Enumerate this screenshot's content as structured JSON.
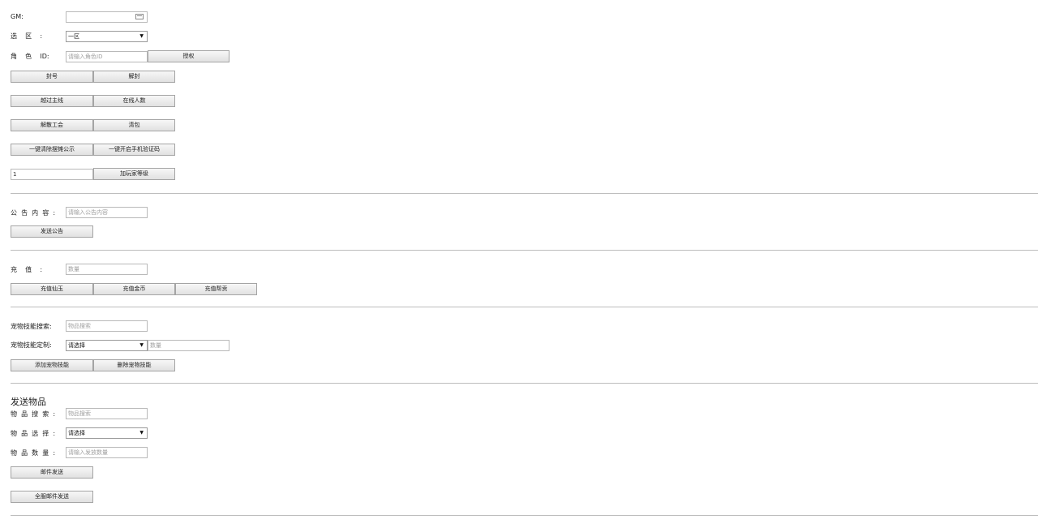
{
  "gm": {
    "label": "GM:",
    "value": ""
  },
  "zone": {
    "label": "选    区    :",
    "selected": "一区"
  },
  "role": {
    "label": "角    色    ID:",
    "placeholder": "请输入角色ID",
    "authorize_btn": "授权"
  },
  "row_ban": {
    "ban": "封号",
    "unban": "解封"
  },
  "row_main": {
    "skip_main": "越过主线",
    "online": "在线人数"
  },
  "row_guild": {
    "disband": "解散工会",
    "clear_bag": "清包"
  },
  "row_onekey": {
    "clear_stall": "一键清除摆摊公示",
    "enable_sms": "一键开启手机验证码"
  },
  "row_level": {
    "value": "1",
    "btn": "加玩家等级"
  },
  "announce": {
    "label": "公  告  内  容  :",
    "placeholder": "请输入公告内容",
    "btn": "发送公告"
  },
  "recharge": {
    "label": "充    值    :",
    "placeholder": "数量",
    "btn_jade": "充值仙玉",
    "btn_gold": "充值金币",
    "btn_guild": "充值帮贡"
  },
  "pet": {
    "search_label": "宠物技能搜索:",
    "search_placeholder": "物品搜索",
    "custom_label": "宠物技能定制:",
    "custom_selected": "请选择",
    "qty_placeholder": "数量",
    "add_btn": "添加宠物技能",
    "del_btn": "删除宠物技能"
  },
  "send": {
    "title": "发送物品",
    "search_label": "物  品  搜  索  :",
    "search_placeholder": "物品搜索",
    "select_label": "物  品  选  择  :",
    "select_selected": "请选择",
    "qty_label": "物  品  数  量  :",
    "qty_placeholder": "请输入发放数量",
    "mail_btn": "邮件发送",
    "all_mail_btn": "全服邮件发送"
  }
}
